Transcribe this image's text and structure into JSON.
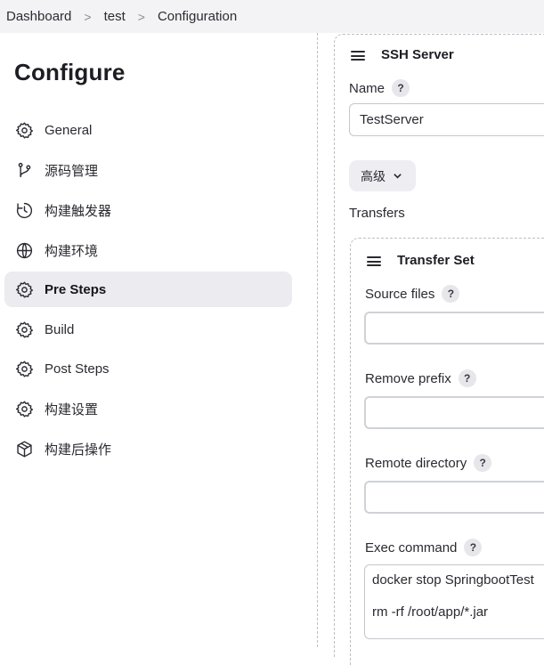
{
  "breadcrumb": {
    "items": [
      "Dashboard",
      "test",
      "Configuration"
    ],
    "separator": ">"
  },
  "sidebar": {
    "title": "Configure",
    "items": [
      {
        "label": "General",
        "icon": "gear-icon",
        "active": false
      },
      {
        "label": "源码管理",
        "icon": "branch-icon",
        "active": false
      },
      {
        "label": "构建触发器",
        "icon": "clock-icon",
        "active": false
      },
      {
        "label": "构建环境",
        "icon": "globe-icon",
        "active": false
      },
      {
        "label": "Pre Steps",
        "icon": "gear-icon",
        "active": true
      },
      {
        "label": "Build",
        "icon": "gear-icon",
        "active": false
      },
      {
        "label": "Post Steps",
        "icon": "gear-icon",
        "active": false
      },
      {
        "label": "构建设置",
        "icon": "gear-icon",
        "active": false
      },
      {
        "label": "构建后操作",
        "icon": "package-icon",
        "active": false
      }
    ]
  },
  "ssh_server": {
    "title": "SSH Server",
    "name_label": "Name",
    "name_value": "TestServer",
    "advanced_label": "高级",
    "transfers_label": "Transfers",
    "transfer_set": {
      "title": "Transfer Set",
      "source_files_label": "Source files",
      "source_files_value": "",
      "remove_prefix_label": "Remove prefix",
      "remove_prefix_value": "",
      "remote_directory_label": "Remote directory",
      "remote_directory_value": "",
      "exec_command_label": "Exec command",
      "exec_command_lines": [
        "docker stop SpringbootTest",
        "",
        "rm -rf /root/app/*.jar"
      ]
    }
  },
  "help_glyph": "?",
  "colors": {
    "active_bg": "#ebebf0",
    "breadcrumb_bg": "#f3f3f6",
    "border": "#c6c6ce"
  }
}
